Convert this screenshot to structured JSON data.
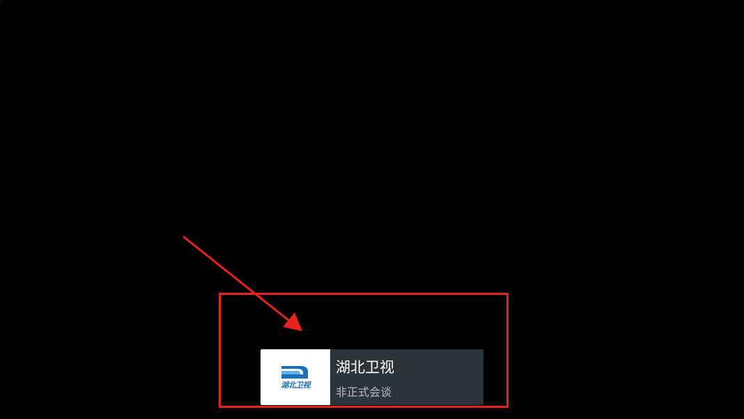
{
  "channel": {
    "name": "湖北卫视",
    "program": "非正式会谈",
    "logo_text": "湖北卫视",
    "logo_icon": "hubei-tv-logo"
  },
  "colors": {
    "background": "#000000",
    "card_info_bg": "#2c3339",
    "annotation_red": "#e8231f",
    "logo_blue": "#1d6fb8"
  }
}
